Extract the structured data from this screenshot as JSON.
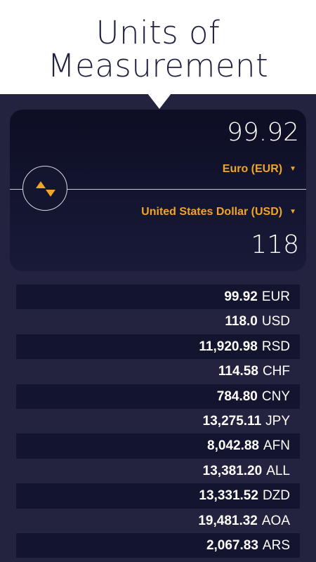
{
  "header": {
    "title_line1": "Units of",
    "title_line2": "Measurement"
  },
  "converter": {
    "top_value": "99.92",
    "top_currency": "Euro (EUR)",
    "bottom_currency": "United States Dollar (USD)",
    "bottom_value": "118",
    "caret": "▼",
    "accent_color": "#f0a428"
  },
  "rates": [
    {
      "amount": "99.92",
      "code": "EUR"
    },
    {
      "amount": "118.0",
      "code": "USD"
    },
    {
      "amount": "11,920.98",
      "code": "RSD"
    },
    {
      "amount": "114.58",
      "code": "CHF"
    },
    {
      "amount": "784.80",
      "code": "CNY"
    },
    {
      "amount": "13,275.11",
      "code": "JPY"
    },
    {
      "amount": "8,042.88",
      "code": "AFN"
    },
    {
      "amount": "13,381.20",
      "code": "ALL"
    },
    {
      "amount": "13,331.52",
      "code": "DZD"
    },
    {
      "amount": "19,481.32",
      "code": "AOA"
    },
    {
      "amount": "2,067.83",
      "code": "ARS"
    }
  ]
}
